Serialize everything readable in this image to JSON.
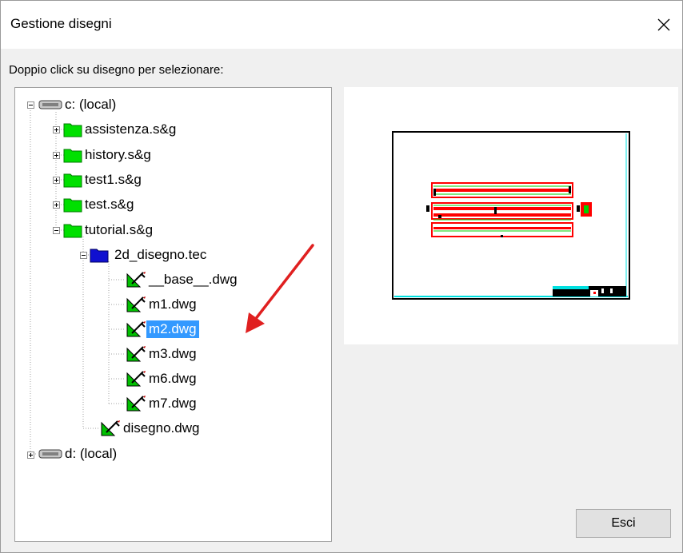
{
  "window": {
    "title": "Gestione disegni",
    "close_icon": "close-icon"
  },
  "prompt": "Doppio click su disegno per selezionare:",
  "tree": {
    "drive_c": "c: (local)",
    "folders": [
      "assistenza.s&g",
      "history.s&g",
      "test1.s&g",
      "test.s&g",
      "tutorial.s&g"
    ],
    "subfolder": "2d_disegno.tec",
    "drawings": [
      "__base__.dwg",
      "m1.dwg",
      "m2.dwg",
      "m3.dwg",
      "m6.dwg",
      "m7.dwg"
    ],
    "selected": "m2.dwg",
    "tutorial_file": "disegno.dwg",
    "drive_d": "d: (local)"
  },
  "buttons": {
    "esci": "Esci"
  },
  "colors": {
    "folder": "#00e000",
    "selection": "#3399ff",
    "annotation_arrow": "#e02020"
  }
}
